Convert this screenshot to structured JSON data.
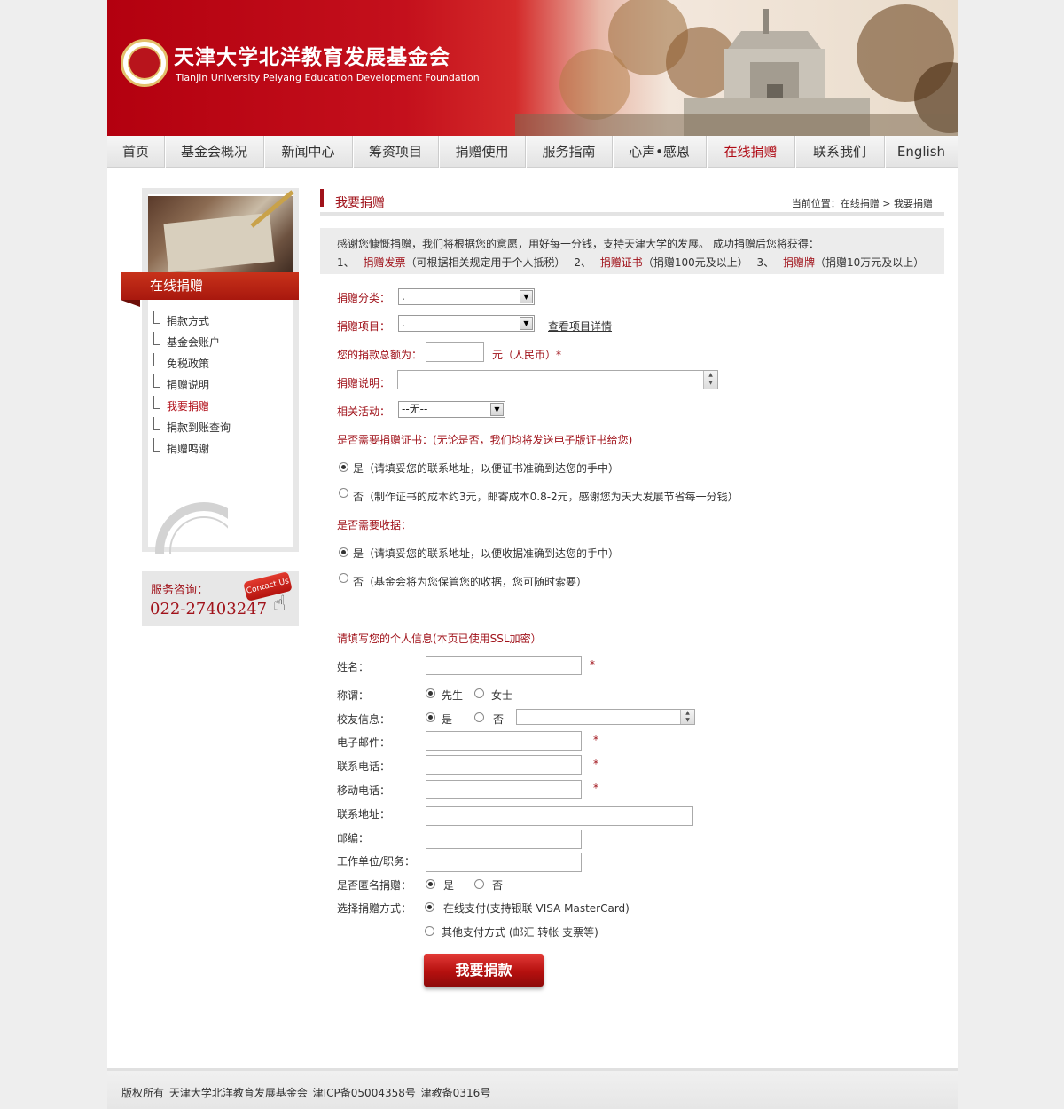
{
  "header": {
    "cn_title": "天津大学北洋教育发展基金会",
    "en_title": "Tianjin University Peiyang Education Development Foundation"
  },
  "nav": {
    "items": [
      {
        "label": "首页",
        "active": false
      },
      {
        "label": "基金会概况",
        "active": false
      },
      {
        "label": "新闻中心",
        "active": false
      },
      {
        "label": "筹资项目",
        "active": false
      },
      {
        "label": "捐赠使用",
        "active": false
      },
      {
        "label": "服务指南",
        "active": false
      },
      {
        "label": "心声•感恩",
        "active": false
      },
      {
        "label": "在线捐赠",
        "active": true
      },
      {
        "label": "联系我们",
        "active": false
      },
      {
        "label": "English",
        "active": false
      }
    ]
  },
  "sidebar": {
    "title": "在线捐赠",
    "items": [
      {
        "label": "捐款方式"
      },
      {
        "label": "基金会账户"
      },
      {
        "label": "免税政策"
      },
      {
        "label": "捐赠说明"
      },
      {
        "label": "我要捐赠"
      },
      {
        "label": "捐款到账查询"
      },
      {
        "label": "捐赠鸣谢"
      }
    ],
    "active_index": 4,
    "service_label": "服务咨询：",
    "service_phone": "022-27403247",
    "contact_badge": "Contact Us"
  },
  "main": {
    "title": "我要捐赠",
    "breadcrumb": "当前位置：在线捐赠 > 我要捐赠",
    "intro": {
      "line1": "感谢您慷慨捐赠，我们将根据您的意愿，用好每一分钱，支持天津大学的发展。 成功捐赠后您将获得：",
      "n1": "1、",
      "r1": "捐赠发票",
      "t1": "（可根据相关规定用于个人抵税）",
      "n2": "2、",
      "r2": "捐赠证书",
      "t2": "（捐赠100元及以上）",
      "n3": "3、",
      "r3": "捐赠牌",
      "t3": "（捐赠10万元及以上）"
    }
  },
  "form": {
    "category_label": "捐赠分类：",
    "category_value": ".",
    "project_label": "捐赠项目：",
    "project_value": ".",
    "project_detail_link": "查看项目详情",
    "amount_label": "您的捐款总额为：",
    "amount_value": "",
    "amount_unit": "元（人民币）*",
    "note_label": "捐赠说明：",
    "activity_label": "相关活动：",
    "activity_value": "--无--",
    "certificate_question": "是否需要捐赠证书：(无论是否，我们均将发送电子版证书给您)",
    "certificate_yes": "是（请填妥您的联系地址，以便证书准确到达您的手中）",
    "certificate_no": "否（制作证书的成本约3元，邮寄成本0.8-2元，感谢您为天大发展节省每一分钱）",
    "receipt_question": "是否需要收据：",
    "receipt_yes": "是（请填妥您的联系地址，以便收据准确到达您的手中）",
    "receipt_no": "否（基金会将为您保管您的收据，您可随时索要）",
    "personal_heading": "请填写您的个人信息(本页已使用SSL加密）",
    "name_label": "姓名：",
    "title_label": "称谓：",
    "title_male": "先生",
    "title_female": "女士",
    "alumni_label": "校友信息：",
    "alumni_yes": "是",
    "alumni_no": "否",
    "email_label": "电子邮件：",
    "phone_label": "联系电话：",
    "mobile_label": "移动电话：",
    "address_label": "联系地址：",
    "zip_label": "邮编：",
    "work_label": "工作单位/职务：",
    "anonymous_label": "是否匿名捐赠：",
    "anonymous_yes": "是",
    "anonymous_no": "否",
    "pay_label": "选择捐赠方式：",
    "pay_online": "在线支付(支持银联 VISA MasterCard)",
    "pay_other": "其他支付方式 (邮汇 转帐 支票等)",
    "required_mark": "*",
    "submit_label": "我要捐款"
  },
  "footer": {
    "text": "版权所有 天津大学北洋教育发展基金会   津ICP备05004358号   津教备0316号"
  },
  "colors": {
    "brand_red": "#a0121a",
    "header_red": "#c4101c"
  }
}
